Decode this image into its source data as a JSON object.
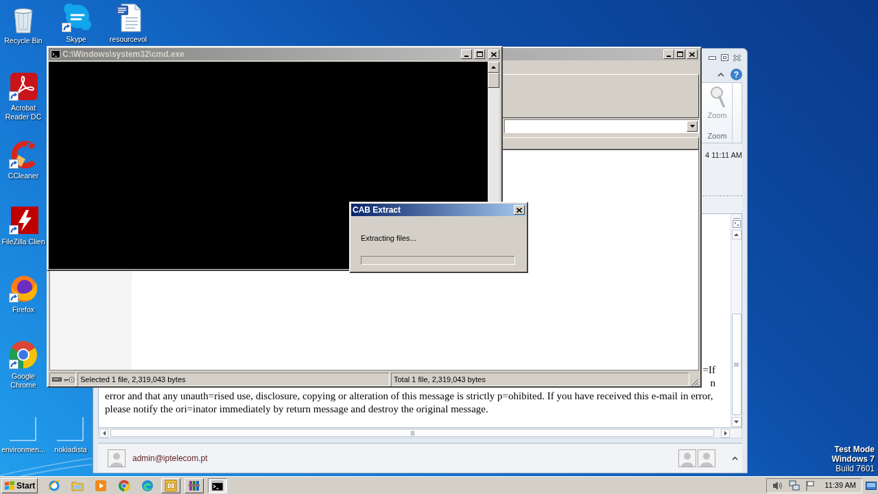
{
  "desktop": {
    "icons": [
      {
        "label": "Recycle Bin",
        "kind": "recycle-bin",
        "shortcut": false
      },
      {
        "label": "Skype",
        "kind": "skype",
        "shortcut": true
      },
      {
        "label": "resourcevol",
        "kind": "word-document",
        "shortcut": false
      },
      {
        "label": "Acrobat Reader DC",
        "kind": "acrobat",
        "shortcut": true
      },
      {
        "label": "CCleaner",
        "kind": "ccleaner",
        "shortcut": true
      },
      {
        "label": "FileZilla Clien",
        "kind": "filezilla",
        "shortcut": true
      },
      {
        "label": "Firefox",
        "kind": "firefox",
        "shortcut": true
      },
      {
        "label": "Google Chrome",
        "kind": "chrome",
        "shortcut": true
      },
      {
        "label": "environmen...",
        "kind": "blank",
        "shortcut": false
      },
      {
        "label": "nokiadista",
        "kind": "blank",
        "shortcut": false
      }
    ],
    "test_mode": [
      {
        "text": "Test Mode",
        "bold": true
      },
      {
        "text": "Windows 7",
        "bold": true
      },
      {
        "text": "Build 7601",
        "bold": false
      }
    ]
  },
  "outlook_window": {
    "ribbon": {
      "help_button": "?",
      "zoom_button": {
        "label": "Zoom",
        "disabled": true
      },
      "group_label": "Zoom"
    },
    "header": {
      "time": "4 11:11 AM"
    },
    "body_lines": [
      {
        "text": "=If",
        "kind": "clipped"
      },
      {
        "text": "n",
        "kind": "clipped"
      },
      {
        "text": "error and that any unauth=rised use, disclosure, copying or alteration of this message is strictly p=ohibited. If you have received this e-mail in error,",
        "kind": "full"
      },
      {
        "text": "please notify the ori=inator immediately by return message and destroy the original message.",
        "kind": "full"
      }
    ],
    "people_pane": {
      "sender": "admin@iptelecom.pt"
    }
  },
  "archive_window": {
    "active": false,
    "status_bar": {
      "selected": "Selected 1 file, 2,319,043 bytes",
      "total": "Total 1 file, 2,319,043 bytes"
    }
  },
  "cmd_window": {
    "active": false,
    "title": "C:\\Windows\\system32\\cmd.exe"
  },
  "dialog": {
    "active": true,
    "title": "CAB Extract",
    "message": "Extracting files...",
    "progress": {
      "level": 0
    }
  },
  "taskbar": {
    "start": "Start",
    "apps": [
      {
        "kind": "internet-explorer",
        "running": false,
        "selected": false
      },
      {
        "kind": "file-explorer",
        "running": false,
        "selected": false
      },
      {
        "kind": "media-player",
        "running": false,
        "selected": false
      },
      {
        "kind": "chrome",
        "running": false,
        "selected": false
      },
      {
        "kind": "edge",
        "running": false,
        "selected": false
      },
      {
        "kind": "outlook",
        "running": true,
        "selected": false
      },
      {
        "kind": "winrar",
        "running": true,
        "selected": false
      },
      {
        "kind": "cmd",
        "running": true,
        "selected": true
      }
    ],
    "clock": "11:39 AM"
  }
}
